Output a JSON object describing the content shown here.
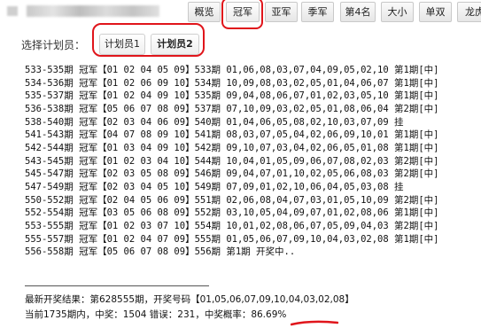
{
  "tabs": [
    "概览",
    "冠军",
    "亚军",
    "季军",
    "第4名",
    "大小",
    "单双",
    "龙虎"
  ],
  "plan": {
    "label": "选择计划员：",
    "buttons": [
      "计划员1",
      "计划员2"
    ]
  },
  "rows": [
    "533-535期 冠军【01 02 04 05 09】533期 01,06,08,03,07,04,09,05,02,10 第1期[中]",
    "534-536期 冠军【01 02 06 09 10】534期 10,09,08,03,02,05,01,04,06,07 第1期[中]",
    "535-537期 冠军【01 02 04 09 10】535期 09,04,08,06,07,01,02,03,05,10 第1期[中]",
    "536-538期 冠军【05 06 07 08 09】537期 07,10,09,03,02,05,01,08,06,04 第2期[中]",
    "538-540期 冠军【02 03 04 06 09】540期 01,04,06,05,08,02,10,03,07,09 挂",
    "541-543期 冠军【04 07 08 09 10】541期 08,03,07,05,04,02,06,09,10,01 第1期[中]",
    "542-544期 冠军【01 03 04 09 10】542期 09,10,07,03,04,02,06,05,01,08 第1期[中]",
    "543-545期 冠军【01 02 03 04 10】544期 10,04,01,05,09,06,07,08,02,03 第2期[中]",
    "545-547期 冠军【02 03 05 08 09】546期 09,04,07,01,10,02,05,06,08,03 第2期[中]",
    "547-549期 冠军【02 03 04 05 10】549期 07,09,01,02,10,06,04,05,03,08 挂",
    "550-552期 冠军【02 04 05 06 09】551期 02,06,08,04,07,03,01,05,10,09 第2期[中]",
    "552-554期 冠军【03 05 06 08 09】552期 03,10,05,04,09,07,01,02,08,06 第1期[中]",
    "553-555期 冠军【01 02 03 07 10】554期 10,01,02,08,06,07,05,09,04,03 第2期[中]",
    "555-557期 冠军【01 02 04 07 09】555期 01,05,06,07,09,10,04,03,02,08 第1期[中]",
    "556-558期 冠军【05 06 07 08 09】556期 第1期 开奖中.."
  ],
  "divider_text": "——————————————————————",
  "footer": {
    "line1": "最新开奖结果：第628555期，开奖号码【01,05,06,07,09,10,04,03,02,08】",
    "line2": "当前1735期内，中奖：1504 错误：231，中奖概率：86.69%"
  },
  "colors": {
    "highlight_ring": "#e0151b",
    "underline": "#e0151b"
  }
}
